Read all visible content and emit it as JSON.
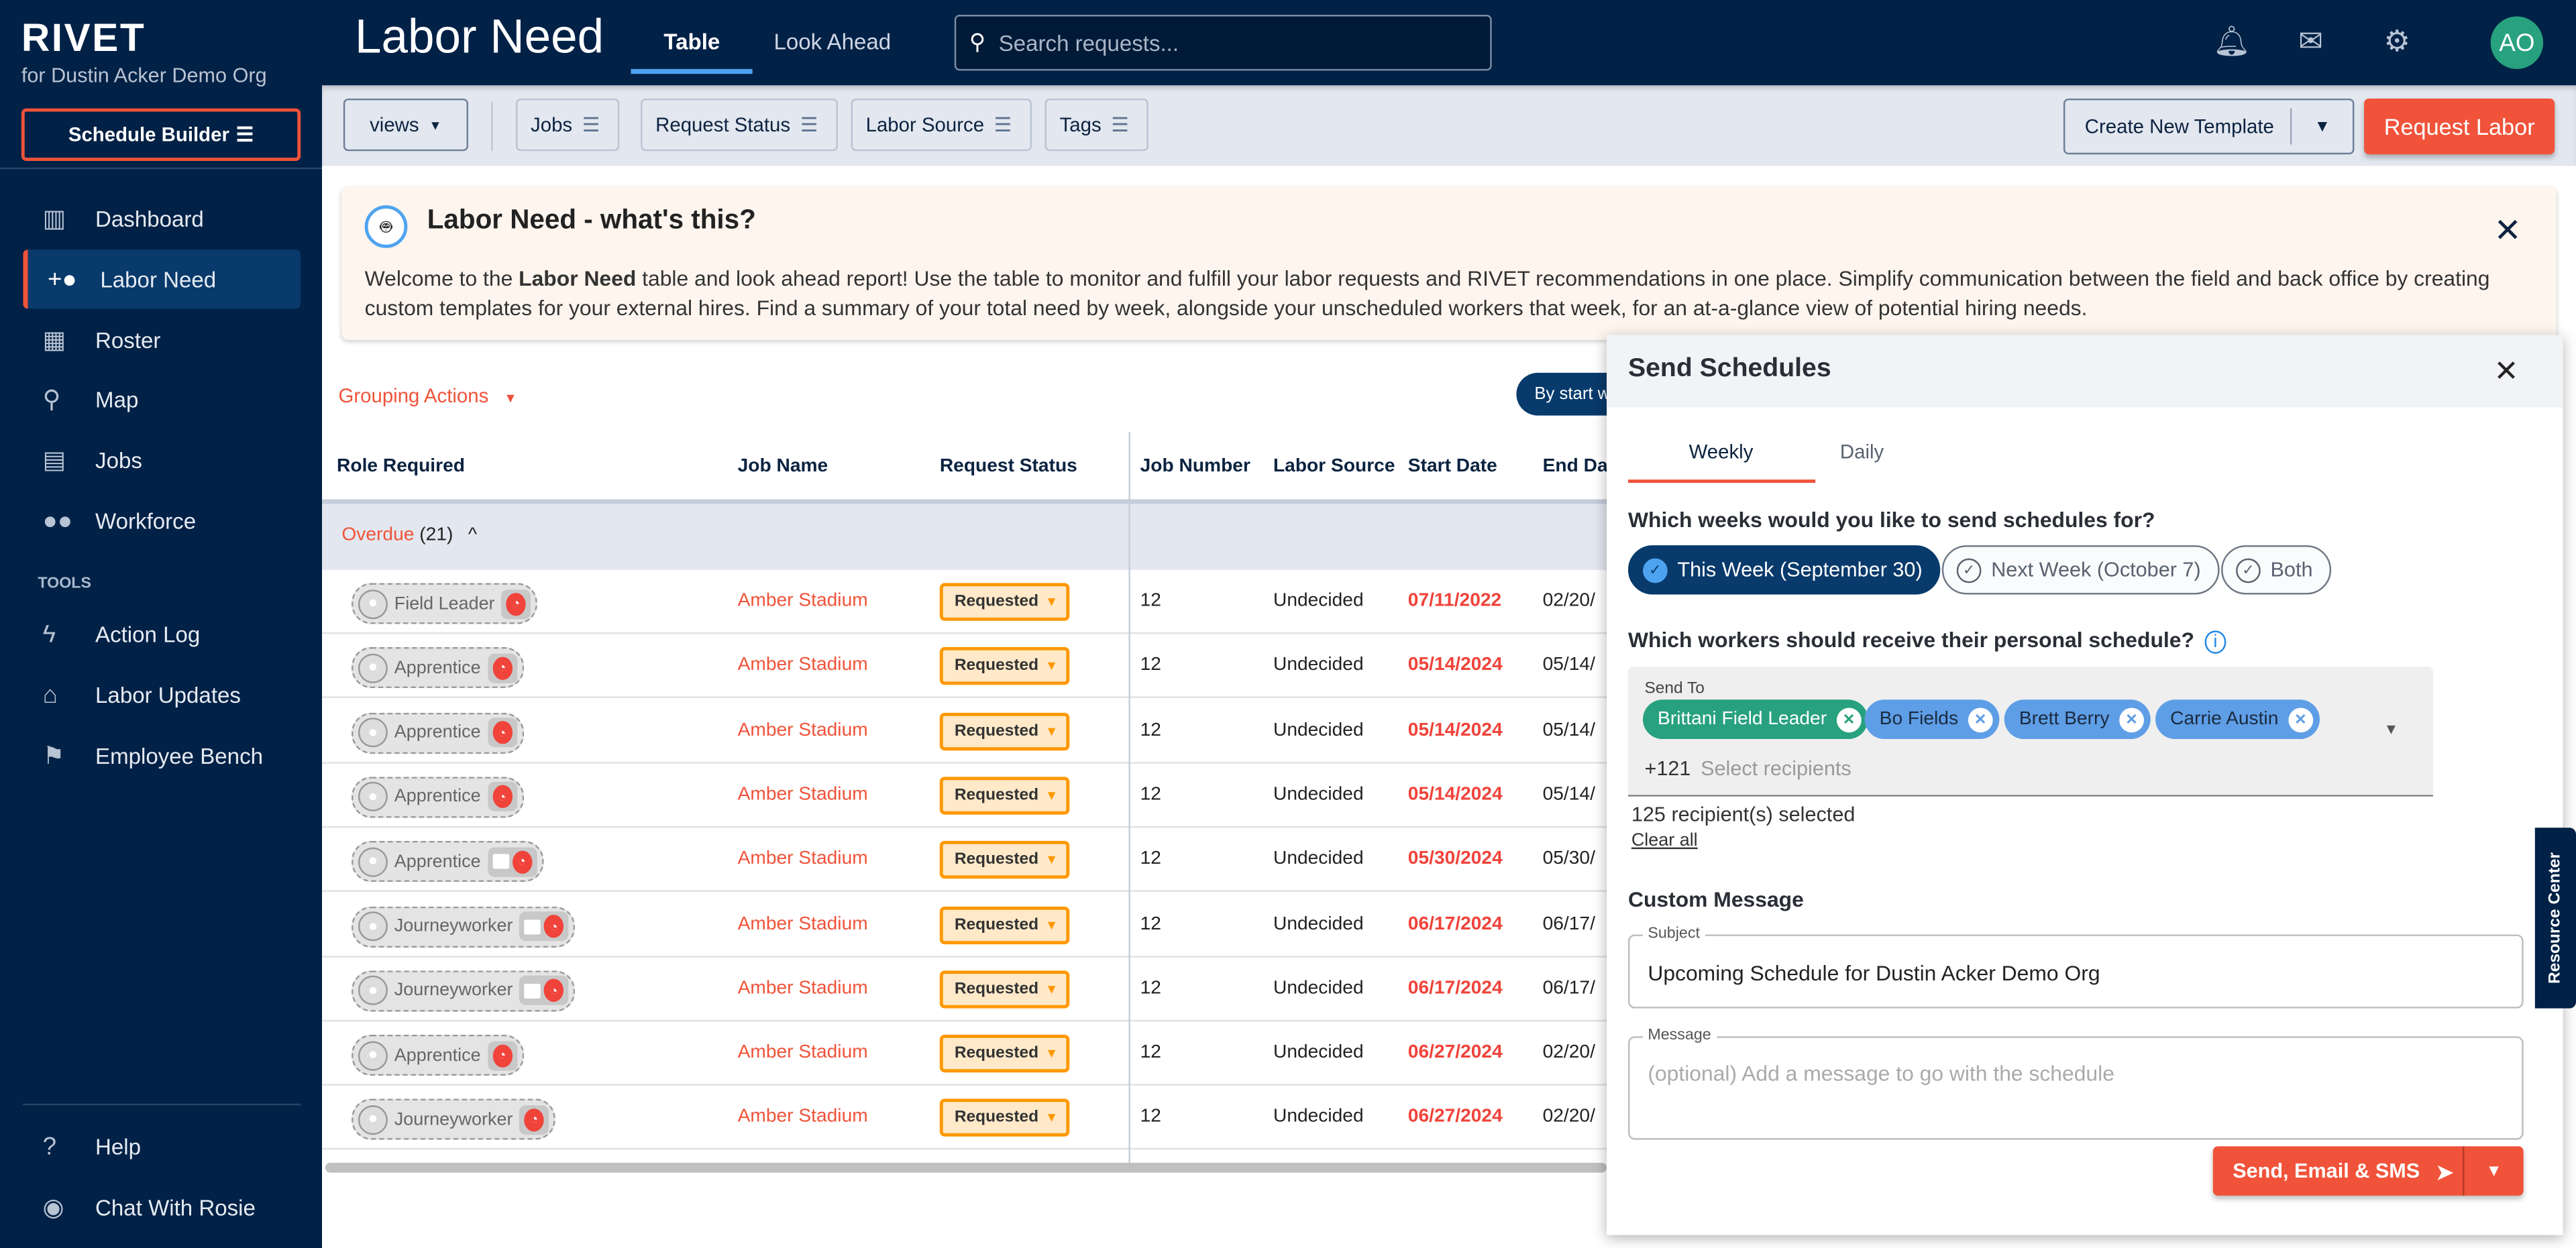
{
  "app": {
    "logo": "RIVET",
    "org": "for Dustin Acker Demo Org",
    "schedule_builder": "Schedule Builder"
  },
  "sidebar": {
    "items": [
      {
        "label": "Dashboard",
        "icon": "bar-chart-icon"
      },
      {
        "label": "Labor Need",
        "icon": "person-add-icon",
        "active": true
      },
      {
        "label": "Roster",
        "icon": "table-icon"
      },
      {
        "label": "Map",
        "icon": "map-pin-icon"
      },
      {
        "label": "Jobs",
        "icon": "building-icon"
      },
      {
        "label": "Workforce",
        "icon": "people-icon"
      }
    ],
    "tools_heading": "TOOLS",
    "tools": [
      {
        "label": "Action Log",
        "icon": "bolt-icon"
      },
      {
        "label": "Labor Updates",
        "icon": "broadcast-icon"
      },
      {
        "label": "Employee Bench",
        "icon": "flag-icon"
      }
    ],
    "footer": [
      {
        "label": "Help",
        "icon": "help-icon"
      },
      {
        "label": "Chat With Rosie",
        "icon": "rosie-icon"
      }
    ]
  },
  "header": {
    "title": "Labor Need",
    "tabs": [
      "Table",
      "Look Ahead"
    ],
    "active_tab": "Table",
    "search_placeholder": "Search requests...",
    "avatar": "AO"
  },
  "toolbar": {
    "views": "views",
    "filters": [
      "Jobs",
      "Request Status",
      "Labor Source",
      "Tags"
    ],
    "create_template": "Create New Template",
    "request_labor": "Request Labor"
  },
  "banner": {
    "title": "Labor Need - what's this?",
    "text_pre": "Welcome to the ",
    "text_bold": "Labor Need",
    "text_post": " table and look ahead report! Use the table to monitor and fulfill your labor requests and RIVET recommendations in one place. Simplify communication between the field and back office by creating custom templates for your external hires. Find a summary of your total need by week, alongside your unscheduled workers that week, for an at-a-glance view of potential hiring needs."
  },
  "table": {
    "grouping_actions": "Grouping Actions",
    "by_start": "By start w",
    "columns": [
      "Role Required",
      "Job Name",
      "Request Status",
      "Job Number",
      "Labor Source",
      "Start Date",
      "End Date"
    ],
    "group": {
      "label": "Overdue",
      "count": "(21)"
    },
    "rows": [
      {
        "role": "Field Leader",
        "msg": false,
        "job": "Amber Stadium",
        "status": "Requested",
        "job_number": "12",
        "source": "Undecided",
        "start": "07/11/2022",
        "end": "02/20/"
      },
      {
        "role": "Apprentice",
        "msg": false,
        "job": "Amber Stadium",
        "status": "Requested",
        "job_number": "12",
        "source": "Undecided",
        "start": "05/14/2024",
        "end": "05/14/"
      },
      {
        "role": "Apprentice",
        "msg": false,
        "job": "Amber Stadium",
        "status": "Requested",
        "job_number": "12",
        "source": "Undecided",
        "start": "05/14/2024",
        "end": "05/14/"
      },
      {
        "role": "Apprentice",
        "msg": false,
        "job": "Amber Stadium",
        "status": "Requested",
        "job_number": "12",
        "source": "Undecided",
        "start": "05/14/2024",
        "end": "05/14/"
      },
      {
        "role": "Apprentice",
        "msg": true,
        "job": "Amber Stadium",
        "status": "Requested",
        "job_number": "12",
        "source": "Undecided",
        "start": "05/30/2024",
        "end": "05/30/"
      },
      {
        "role": "Journeyworker",
        "msg": true,
        "job": "Amber Stadium",
        "status": "Requested",
        "job_number": "12",
        "source": "Undecided",
        "start": "06/17/2024",
        "end": "06/17/"
      },
      {
        "role": "Journeyworker",
        "msg": true,
        "job": "Amber Stadium",
        "status": "Requested",
        "job_number": "12",
        "source": "Undecided",
        "start": "06/17/2024",
        "end": "06/17/"
      },
      {
        "role": "Apprentice",
        "msg": false,
        "job": "Amber Stadium",
        "status": "Requested",
        "job_number": "12",
        "source": "Undecided",
        "start": "06/27/2024",
        "end": "02/20/"
      },
      {
        "role": "Journeyworker",
        "msg": false,
        "job": "Amber Stadium",
        "status": "Requested",
        "job_number": "12",
        "source": "Undecided",
        "start": "06/27/2024",
        "end": "02/20/"
      }
    ]
  },
  "panel": {
    "title": "Send Schedules",
    "tabs": [
      "Weekly",
      "Daily"
    ],
    "active_tab": "Weekly",
    "weeks_question": "Which weeks would you like to send schedules for?",
    "week_options": [
      {
        "label": "This Week (September 30)",
        "selected": true
      },
      {
        "label": "Next Week (October 7)",
        "selected": false
      },
      {
        "label": "Both",
        "selected": false
      }
    ],
    "workers_question": "Which workers should receive their personal schedule?",
    "send_to_label": "Send To",
    "recipients": [
      {
        "name": "Brittani Field Leader",
        "color": "#28a17f"
      },
      {
        "name": "Bo Fields",
        "color": "#5e9ee6"
      },
      {
        "name": "Brett Berry",
        "color": "#5e9ee6"
      },
      {
        "name": "Carrie Austin",
        "color": "#5e9ee6"
      }
    ],
    "more_count": "+121",
    "recipients_placeholder": "Select recipients",
    "selected_count": "125 recipient(s) selected",
    "clear_all": "Clear all",
    "custom_message": "Custom Message",
    "subject_label": "Subject",
    "subject_value": "Upcoming Schedule for Dustin Acker Demo Org",
    "message_label": "Message",
    "message_placeholder": "(optional) Add a message to go with the schedule",
    "send_button": "Send, Email & SMS"
  },
  "resource_center": "Resource Center",
  "colors": {
    "navy": "#012146",
    "accent": "#f0533a",
    "status_orange": "#ff9800",
    "active_nav": "#083a6b"
  }
}
